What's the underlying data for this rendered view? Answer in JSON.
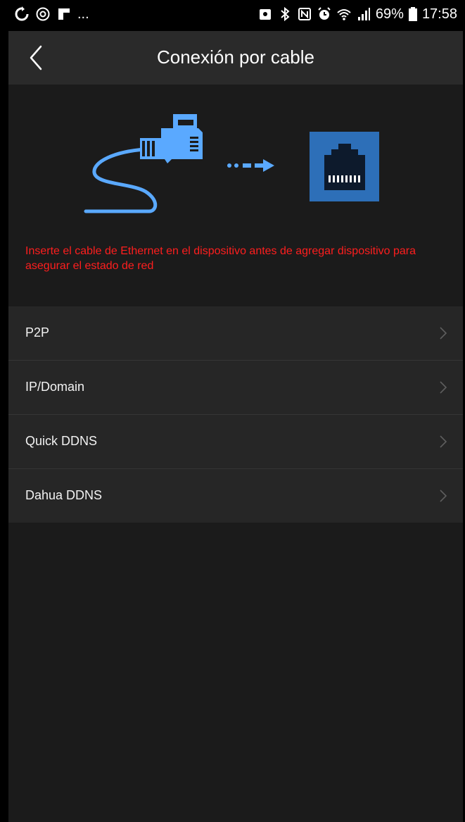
{
  "status_bar": {
    "left_icons": [
      "sync-icon",
      "sync-circle-icon",
      "flipboard-icon"
    ],
    "left_overflow": "...",
    "right_icons": [
      "lock-icon",
      "bluetooth-icon",
      "nfc-icon",
      "alarm-icon",
      "wifi-icon",
      "signal-icon"
    ],
    "battery_percent": "69%",
    "time": "17:58"
  },
  "header": {
    "title": "Conexión por cable",
    "back_icon": "chevron-left-icon"
  },
  "illustration": {
    "cable_icon": "ethernet-cable-icon",
    "arrow_icon": "dashed-arrow-icon",
    "port_icon": "ethernet-port-icon",
    "accent_color": "#5aa9ff",
    "port_color": "#2d6fb8"
  },
  "notice": "Inserte el cable de Ethernet en el dispositivo antes de agregar dispositivo para asegurar el estado de red",
  "menu": {
    "items": [
      {
        "label": "P2P"
      },
      {
        "label": "IP/Domain"
      },
      {
        "label": "Quick DDNS"
      },
      {
        "label": "Dahua DDNS"
      }
    ],
    "chevron_icon": "chevron-right-icon"
  },
  "colors": {
    "background": "#1b1b1b",
    "header": "#2a2a2a",
    "list": "#262626",
    "notice": "#ff1e1e"
  }
}
